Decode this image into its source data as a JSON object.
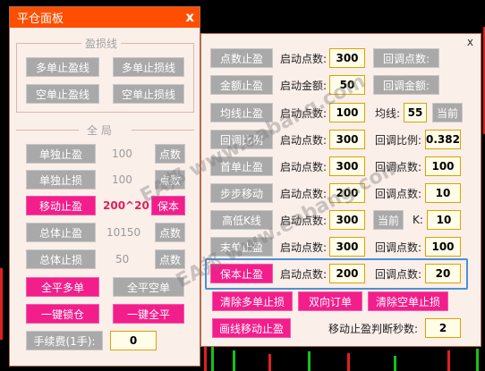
{
  "left_panel": {
    "title": "平仓面板",
    "close": "x",
    "group_profit_loss": "盈损线",
    "btn_multi_tp": "多单止盈线",
    "btn_multi_sl": "多单止损线",
    "btn_short_tp": "空单止盈线",
    "btn_short_sl": "空单止损线",
    "group_global": "全 局",
    "btn_single_tp": "单独止盈",
    "single_tp_value": "100",
    "single_tp_unit": "点数",
    "btn_single_sl": "单独止损",
    "single_sl_value": "100",
    "single_sl_unit": "点数",
    "btn_move_tp": "移动止盈",
    "move_tp_value": "200^20",
    "move_tp_mode": "保本",
    "btn_total_tp": "总体止盈",
    "total_tp_value": "10150",
    "total_tp_unit": "点数",
    "btn_total_sl": "总体止损",
    "total_sl_value": "50",
    "total_sl_unit": "点数",
    "btn_close_all_long": "全平多单",
    "btn_close_all_short": "全平空单",
    "btn_one_click_lock": "一键锁仓",
    "btn_one_click_close": "一键全平",
    "fee_label": "手续费(1手):",
    "fee_value": "0"
  },
  "right_panel": {
    "close": "x",
    "rows": {
      "points_tp": {
        "btn": "点数止盈",
        "start_label": "启动点数:",
        "start_value": "300",
        "retrace_btn": "回调点数:"
      },
      "amount_tp": {
        "btn": "金额止盈",
        "start_label": "启动金额:",
        "start_value": "50",
        "retrace_btn": "回调金额:"
      },
      "ma_tp": {
        "btn": "均线止盈",
        "start_label": "启动点数:",
        "start_value": "100",
        "ma_label": "均线:",
        "ma_value": "55",
        "current_btn": "当前"
      },
      "ratio_tp": {
        "btn": "回调比例",
        "start_label": "启动点数:",
        "start_value": "300",
        "ratio_label": "回调比例:",
        "ratio_value": "0.382"
      },
      "first_tp": {
        "btn": "首单止盈",
        "start_label": "启动点数:",
        "start_value": "300",
        "retrace_label": "回调点数:",
        "retrace_value": "100"
      },
      "step_move": {
        "btn": "步步移动",
        "start_label": "启动点数:",
        "start_value": "200",
        "retrace_label": "回调点数:",
        "retrace_value": "10"
      },
      "hilo_k": {
        "btn": "高低K线",
        "start_label": "启动点数:",
        "start_value": "300",
        "current_btn": "当前",
        "k_label": "K:",
        "k_value": "10"
      },
      "last_tp": {
        "btn": "末单止盈",
        "start_label": "启动点数:",
        "start_value": "300",
        "retrace_label": "回调点数:",
        "retrace_value": "100"
      },
      "breakeven_tp": {
        "btn": "保本止盈",
        "start_label": "启动点数:",
        "start_value": "200",
        "retrace_label": "回调点数:",
        "retrace_value": "20"
      }
    },
    "btn_clear_long_sl": "清除多单止损",
    "btn_two_way": "双向订单",
    "btn_clear_short_sl": "清除空单止损",
    "btn_draw_line_move_tp": "画线移动止盈",
    "move_tp_judge_label": "移动止盈判断秒数:",
    "move_tp_judge_value": "2"
  },
  "watermark": "EA邦 www.eabang.com"
}
